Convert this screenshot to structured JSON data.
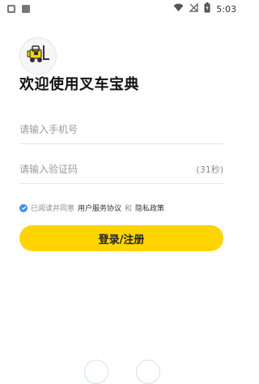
{
  "status_bar": {
    "time": "5:03",
    "left_icons": [
      "app-notification-icon",
      "screenshot-notification-icon"
    ],
    "right_icons": [
      "wifi-icon",
      "no-signal-icon",
      "battery-charging-icon"
    ]
  },
  "app": {
    "logo_icon": "forklift-logo-icon",
    "welcome_text": "欢迎使用叉车宝典"
  },
  "form": {
    "phone_placeholder": "请输入手机号",
    "code_placeholder": "请输入验证码",
    "countdown": "(31秒)"
  },
  "agreement": {
    "prefix": "已阅读并同意",
    "user_agreement": "用户服务协议",
    "and": "和",
    "privacy_policy": "隐私政策",
    "checked": true
  },
  "login_button": {
    "label": "登录/注册"
  },
  "colors": {
    "accent_yellow": "#ffd400",
    "check_blue": "#3f8ef3"
  }
}
